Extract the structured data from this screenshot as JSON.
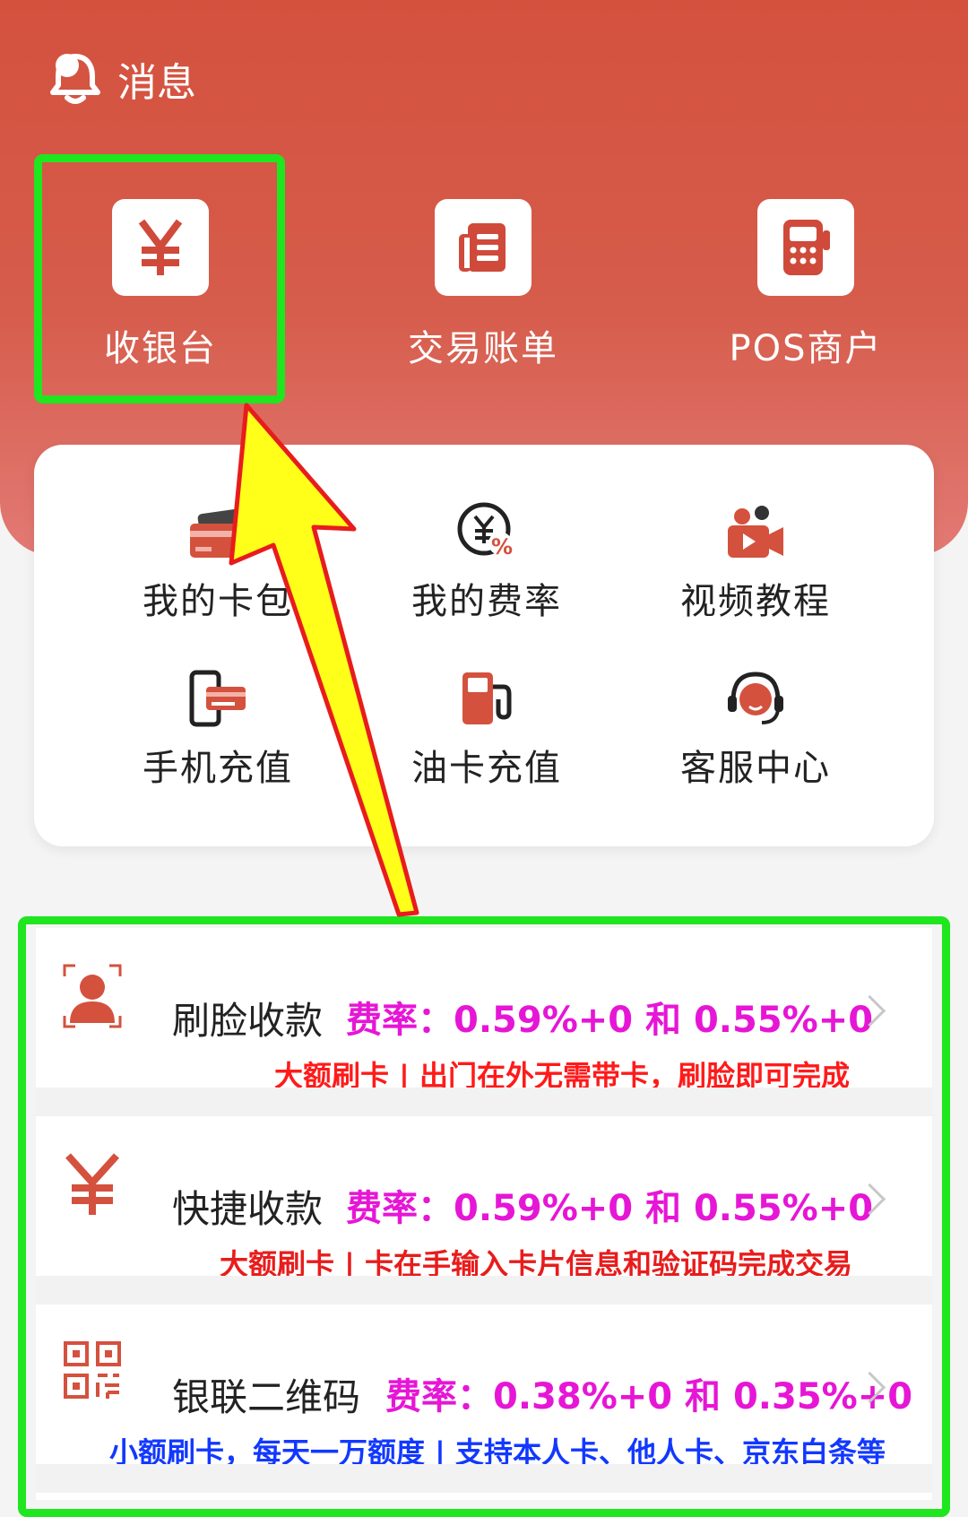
{
  "header": {
    "message_label": "消息"
  },
  "quick_actions": [
    {
      "label": "收银台",
      "icon": "yen-icon"
    },
    {
      "label": "交易账单",
      "icon": "bill-icon"
    },
    {
      "label": "POS商户",
      "icon": "pos-terminal-icon"
    }
  ],
  "services": [
    {
      "label": "我的卡包",
      "icon": "card-wallet-icon"
    },
    {
      "label": "我的费率",
      "icon": "rate-icon"
    },
    {
      "label": "视频教程",
      "icon": "video-camera-icon"
    },
    {
      "label": "手机充值",
      "icon": "phone-recharge-icon"
    },
    {
      "label": "油卡充值",
      "icon": "fuel-pump-icon"
    },
    {
      "label": "客服中心",
      "icon": "headset-icon"
    }
  ],
  "payment_methods": [
    {
      "title": "刷脸收款",
      "rate": "费率：0.59%+0 和 0.55%+0",
      "note": "大额刷卡 | 出门在外无需带卡，刷脸即可完成",
      "note_color": "#ff1a1a",
      "icon": "face-scan-icon"
    },
    {
      "title": "快捷收款",
      "rate": "费率：0.59%+0 和 0.55%+0",
      "note": "大额刷卡 | 卡在手输入卡片信息和验证码完成交易",
      "note_color": "#e81c1c",
      "icon": "yen-icon"
    },
    {
      "title": "银联二维码",
      "rate": "费率：0.38%+0 和 0.35%+0",
      "note": "小额刷卡，每天一万额度 | 支持本人卡、他人卡、京东白条等",
      "note_color": "#1238ff",
      "icon": "qr-code-icon"
    }
  ],
  "colors": {
    "brand_red": "#d4513e",
    "rate_magenta": "#e616d6",
    "highlight_green": "#1fe61f",
    "arrow_yellow": "#ffff1a"
  }
}
